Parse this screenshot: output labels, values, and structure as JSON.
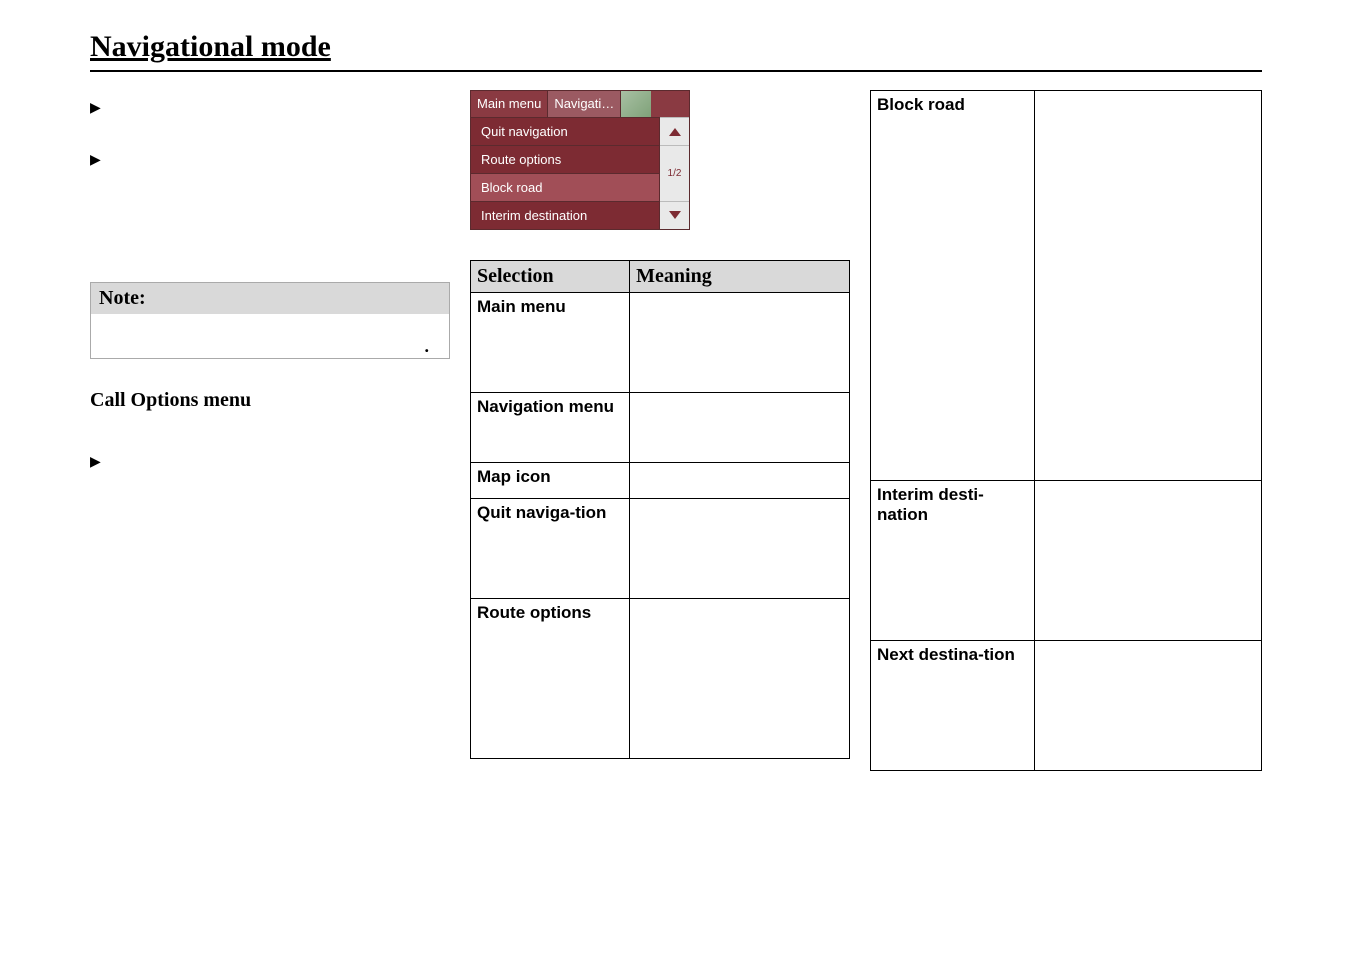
{
  "title": "Navigational mode",
  "note_label": "Note:",
  "sub_heading": "Call Options menu",
  "device": {
    "tab_main": "Main menu",
    "tab_nav": "Navigati…",
    "item_quit": "Quit navigation",
    "item_route": "Route options",
    "item_block": "Block road",
    "item_interim": "Interim destination",
    "page_indicator": "1/2"
  },
  "table1": {
    "head_selection": "Selection",
    "head_meaning": "Meaning",
    "rows": [
      {
        "sel": "Main menu",
        "meaning": ""
      },
      {
        "sel": "Navigation menu",
        "meaning": ""
      },
      {
        "sel": "Map icon",
        "meaning": ""
      },
      {
        "sel": "Quit naviga-tion",
        "meaning": ""
      },
      {
        "sel": "Route options",
        "meaning": ""
      }
    ]
  },
  "table2": {
    "rows": [
      {
        "sel": "Block road",
        "meaning": ""
      },
      {
        "sel": "Interim desti-nation",
        "meaning": ""
      },
      {
        "sel": "Next destina-tion",
        "meaning": ""
      }
    ]
  }
}
